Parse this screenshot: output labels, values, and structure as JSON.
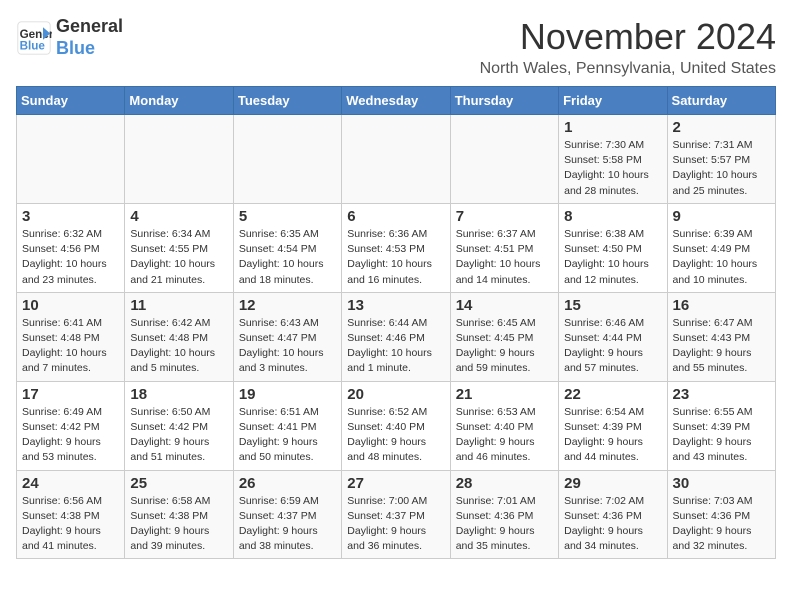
{
  "header": {
    "logo_line1": "General",
    "logo_line2": "Blue",
    "title": "November 2024",
    "location": "North Wales, Pennsylvania, United States"
  },
  "weekdays": [
    "Sunday",
    "Monday",
    "Tuesday",
    "Wednesday",
    "Thursday",
    "Friday",
    "Saturday"
  ],
  "weeks": [
    [
      {
        "day": "",
        "info": ""
      },
      {
        "day": "",
        "info": ""
      },
      {
        "day": "",
        "info": ""
      },
      {
        "day": "",
        "info": ""
      },
      {
        "day": "",
        "info": ""
      },
      {
        "day": "1",
        "info": "Sunrise: 7:30 AM\nSunset: 5:58 PM\nDaylight: 10 hours and 28 minutes."
      },
      {
        "day": "2",
        "info": "Sunrise: 7:31 AM\nSunset: 5:57 PM\nDaylight: 10 hours and 25 minutes."
      }
    ],
    [
      {
        "day": "3",
        "info": "Sunrise: 6:32 AM\nSunset: 4:56 PM\nDaylight: 10 hours and 23 minutes."
      },
      {
        "day": "4",
        "info": "Sunrise: 6:34 AM\nSunset: 4:55 PM\nDaylight: 10 hours and 21 minutes."
      },
      {
        "day": "5",
        "info": "Sunrise: 6:35 AM\nSunset: 4:54 PM\nDaylight: 10 hours and 18 minutes."
      },
      {
        "day": "6",
        "info": "Sunrise: 6:36 AM\nSunset: 4:53 PM\nDaylight: 10 hours and 16 minutes."
      },
      {
        "day": "7",
        "info": "Sunrise: 6:37 AM\nSunset: 4:51 PM\nDaylight: 10 hours and 14 minutes."
      },
      {
        "day": "8",
        "info": "Sunrise: 6:38 AM\nSunset: 4:50 PM\nDaylight: 10 hours and 12 minutes."
      },
      {
        "day": "9",
        "info": "Sunrise: 6:39 AM\nSunset: 4:49 PM\nDaylight: 10 hours and 10 minutes."
      }
    ],
    [
      {
        "day": "10",
        "info": "Sunrise: 6:41 AM\nSunset: 4:48 PM\nDaylight: 10 hours and 7 minutes."
      },
      {
        "day": "11",
        "info": "Sunrise: 6:42 AM\nSunset: 4:48 PM\nDaylight: 10 hours and 5 minutes."
      },
      {
        "day": "12",
        "info": "Sunrise: 6:43 AM\nSunset: 4:47 PM\nDaylight: 10 hours and 3 minutes."
      },
      {
        "day": "13",
        "info": "Sunrise: 6:44 AM\nSunset: 4:46 PM\nDaylight: 10 hours and 1 minute."
      },
      {
        "day": "14",
        "info": "Sunrise: 6:45 AM\nSunset: 4:45 PM\nDaylight: 9 hours and 59 minutes."
      },
      {
        "day": "15",
        "info": "Sunrise: 6:46 AM\nSunset: 4:44 PM\nDaylight: 9 hours and 57 minutes."
      },
      {
        "day": "16",
        "info": "Sunrise: 6:47 AM\nSunset: 4:43 PM\nDaylight: 9 hours and 55 minutes."
      }
    ],
    [
      {
        "day": "17",
        "info": "Sunrise: 6:49 AM\nSunset: 4:42 PM\nDaylight: 9 hours and 53 minutes."
      },
      {
        "day": "18",
        "info": "Sunrise: 6:50 AM\nSunset: 4:42 PM\nDaylight: 9 hours and 51 minutes."
      },
      {
        "day": "19",
        "info": "Sunrise: 6:51 AM\nSunset: 4:41 PM\nDaylight: 9 hours and 50 minutes."
      },
      {
        "day": "20",
        "info": "Sunrise: 6:52 AM\nSunset: 4:40 PM\nDaylight: 9 hours and 48 minutes."
      },
      {
        "day": "21",
        "info": "Sunrise: 6:53 AM\nSunset: 4:40 PM\nDaylight: 9 hours and 46 minutes."
      },
      {
        "day": "22",
        "info": "Sunrise: 6:54 AM\nSunset: 4:39 PM\nDaylight: 9 hours and 44 minutes."
      },
      {
        "day": "23",
        "info": "Sunrise: 6:55 AM\nSunset: 4:39 PM\nDaylight: 9 hours and 43 minutes."
      }
    ],
    [
      {
        "day": "24",
        "info": "Sunrise: 6:56 AM\nSunset: 4:38 PM\nDaylight: 9 hours and 41 minutes."
      },
      {
        "day": "25",
        "info": "Sunrise: 6:58 AM\nSunset: 4:38 PM\nDaylight: 9 hours and 39 minutes."
      },
      {
        "day": "26",
        "info": "Sunrise: 6:59 AM\nSunset: 4:37 PM\nDaylight: 9 hours and 38 minutes."
      },
      {
        "day": "27",
        "info": "Sunrise: 7:00 AM\nSunset: 4:37 PM\nDaylight: 9 hours and 36 minutes."
      },
      {
        "day": "28",
        "info": "Sunrise: 7:01 AM\nSunset: 4:36 PM\nDaylight: 9 hours and 35 minutes."
      },
      {
        "day": "29",
        "info": "Sunrise: 7:02 AM\nSunset: 4:36 PM\nDaylight: 9 hours and 34 minutes."
      },
      {
        "day": "30",
        "info": "Sunrise: 7:03 AM\nSunset: 4:36 PM\nDaylight: 9 hours and 32 minutes."
      }
    ]
  ]
}
